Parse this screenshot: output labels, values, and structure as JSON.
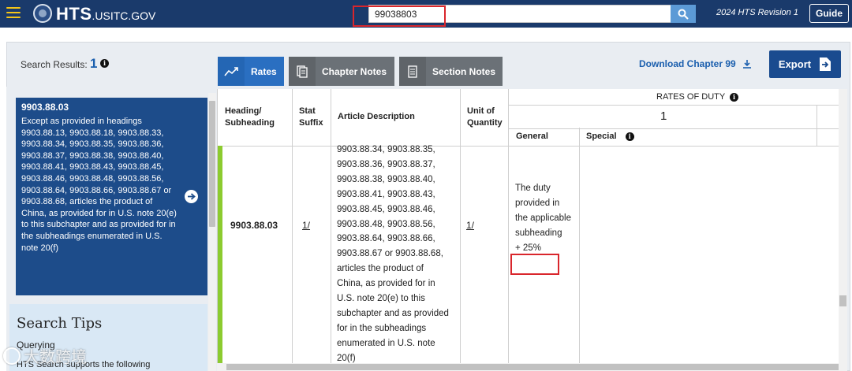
{
  "header": {
    "logo_main": "HTS",
    "logo_domain": ".USITC.GOV",
    "search_value": "99038803",
    "revision": "2024 HTS Revision 1",
    "guide_label": "Guide"
  },
  "toolbar": {
    "results_label": "Search Results:",
    "results_count": "1",
    "tabs": [
      {
        "label": "Rates"
      },
      {
        "label": "Chapter Notes"
      },
      {
        "label": "Section Notes"
      }
    ],
    "download_label": "Download Chapter 99",
    "export_label": "Export"
  },
  "result": {
    "code": "9903.88.03",
    "description": "Except as provided in headings 9903.88.13, 9903.88.18, 9903.88.33, 9903.88.34, 9903.88.35, 9903.88.36, 9903.88.37, 9903.88.38, 9903.88.40, 9903.88.41, 9903.88.43, 9903.88.45, 9903.88.46, 9903.88.48, 9903.88.56, 9903.88.64, 9903.88.66, 9903.88.67 or 9903.88.68, articles the product of China, as provided for in U.S. note 20(e) to this subchapter and as provided for in the subheadings enumerated in U.S. note 20(f)"
  },
  "tips": {
    "title": "Search Tips",
    "subtitle": "Querying",
    "line": "HTS Search supports the following"
  },
  "table": {
    "headers": {
      "heading": "Heading/ Subheading",
      "stat": "Stat Suffix",
      "description": "Article Description",
      "unit": "Unit of Quantity",
      "rates": "RATES OF DUTY",
      "column": "1",
      "general": "General",
      "special": "Special"
    },
    "row": {
      "heading": "9903.88.03",
      "stat": "1/",
      "unit": "1/",
      "description_visible": "9903.88.34, 9903.88.35, 9903.88.36, 9903.88.37, 9903.88.38, 9903.88.40, 9903.88.41, 9903.88.43, 9903.88.45, 9903.88.46, 9903.88.48, 9903.88.56, 9903.88.64, 9903.88.66, 9903.88.67 or 9903.88.68, articles the product of China, as provided for in U.S. note 20(e) to this subchapter and as provided for in the subheadings enumerated in U.S. note 20(f)",
      "general": "The duty provided in the applicable subheading",
      "general_rate": "+ 25%",
      "special": ""
    }
  },
  "watermark": "大数跨境",
  "colors": {
    "header_bg": "#1a3a6b",
    "accent_blue": "#1b5fae",
    "highlight_red": "#d9262c",
    "row_marker_green": "#8ccb2f"
  }
}
